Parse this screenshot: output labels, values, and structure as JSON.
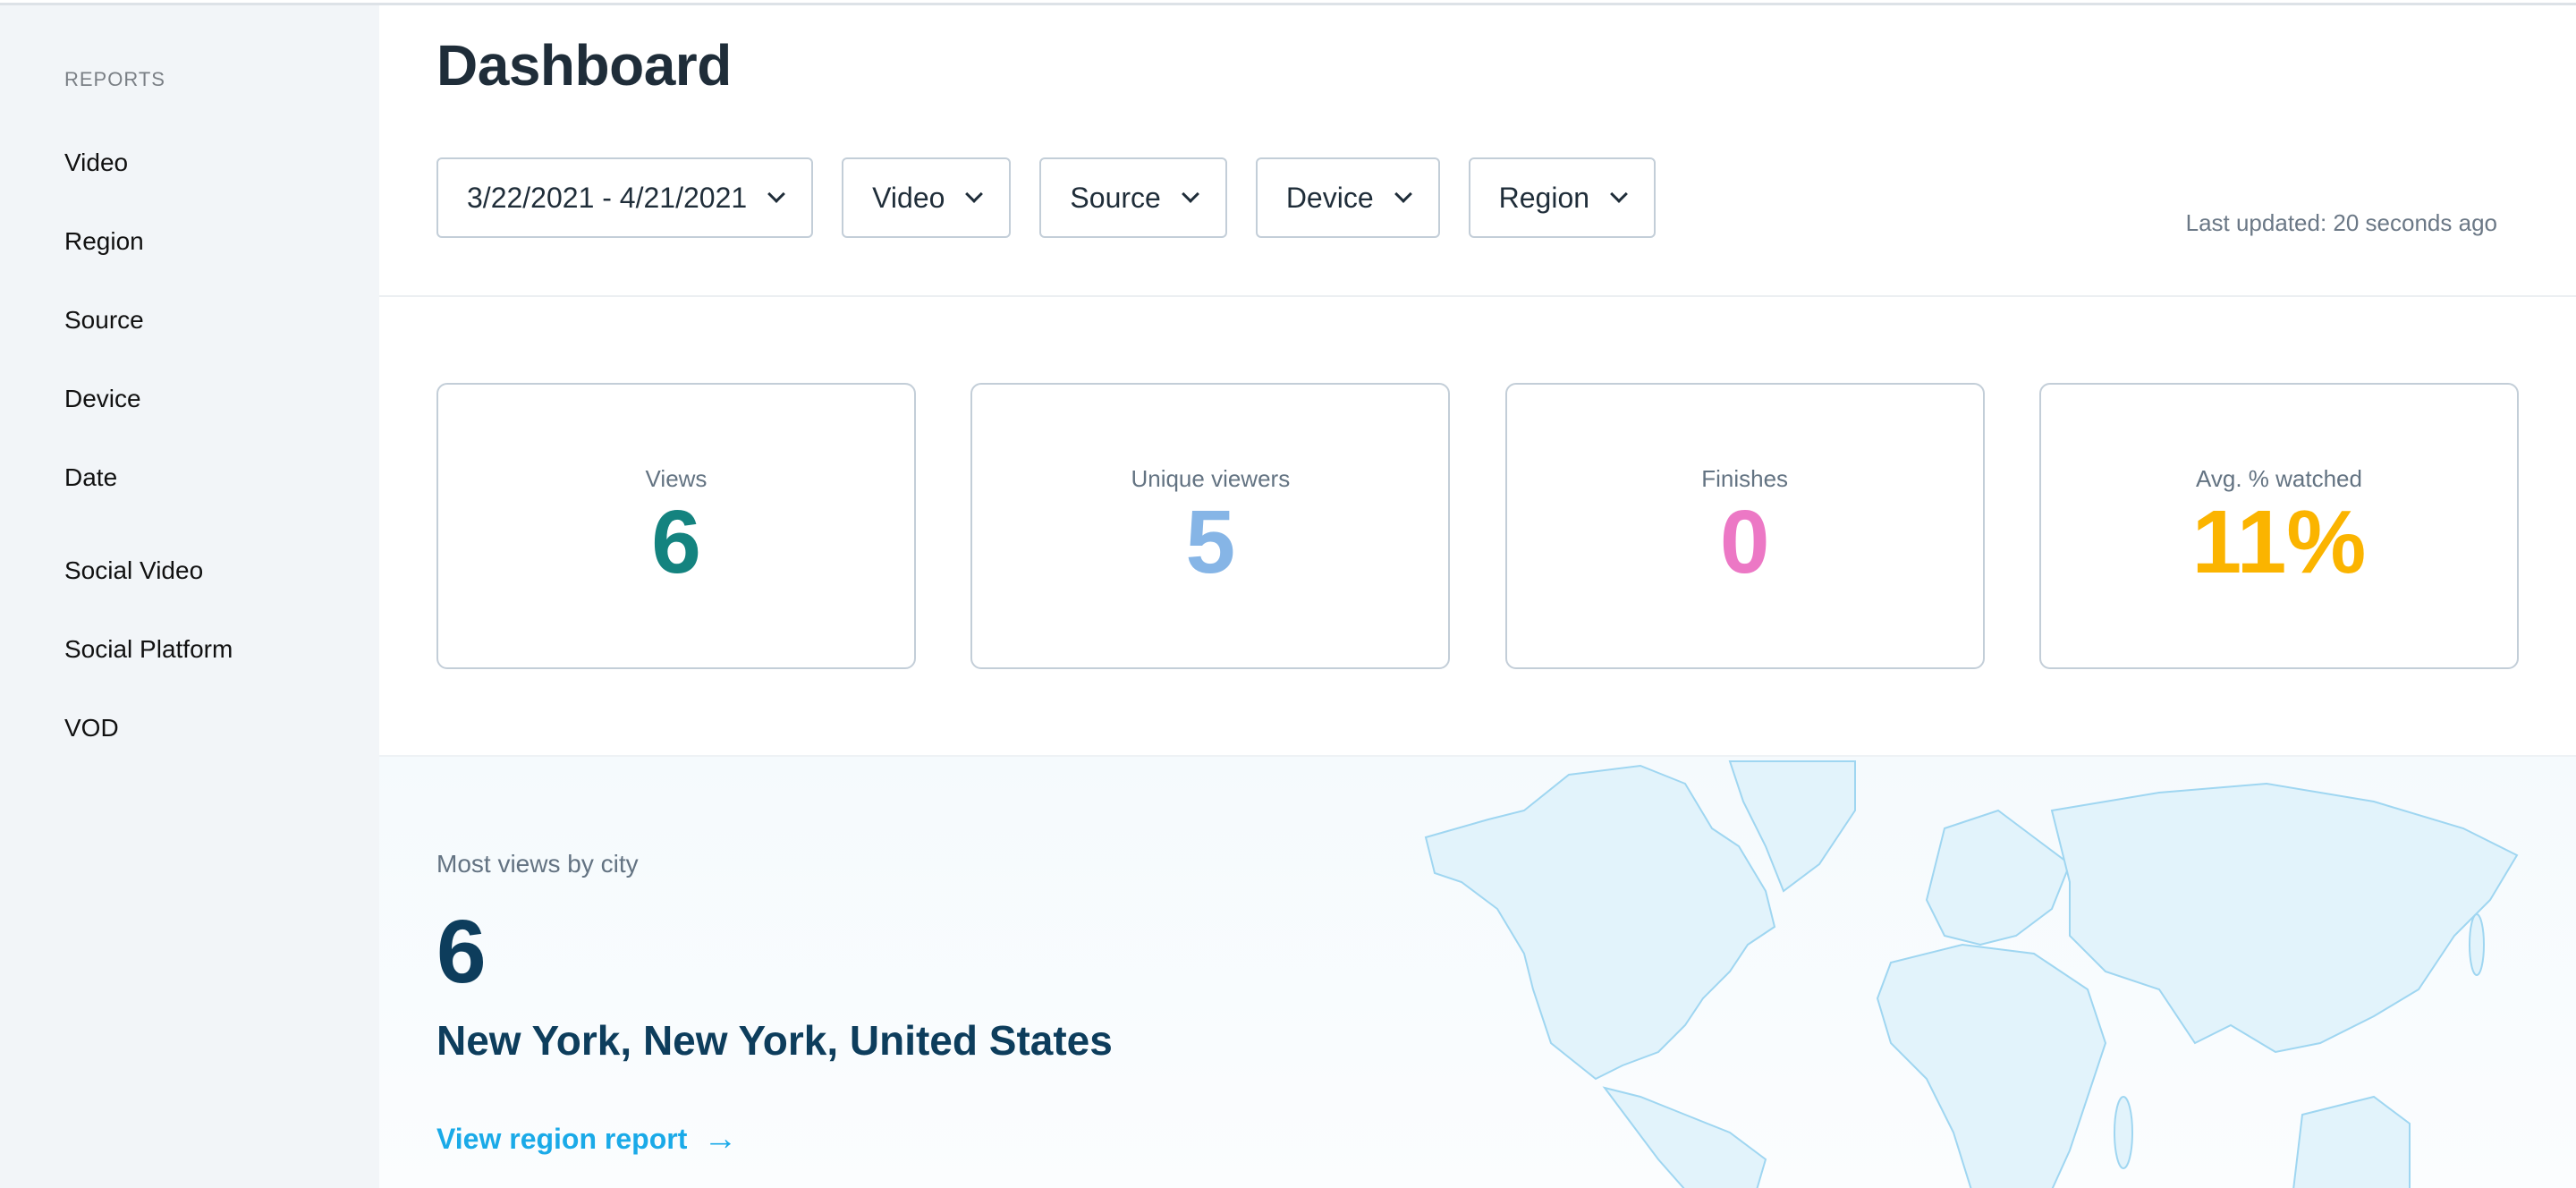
{
  "sidebar": {
    "heading": "REPORTS",
    "items": [
      {
        "label": "Video"
      },
      {
        "label": "Region"
      },
      {
        "label": "Source"
      },
      {
        "label": "Device"
      },
      {
        "label": "Date"
      },
      {
        "label": "Social Video"
      },
      {
        "label": "Social Platform"
      },
      {
        "label": "VOD"
      }
    ]
  },
  "header": {
    "title": "Dashboard",
    "last_updated": "Last updated: 20 seconds ago"
  },
  "filters": [
    {
      "label": "3/22/2021 - 4/21/2021",
      "icon": "chevron-down-icon"
    },
    {
      "label": "Video",
      "icon": "chevron-down-icon"
    },
    {
      "label": "Source",
      "icon": "chevron-down-icon"
    },
    {
      "label": "Device",
      "icon": "chevron-down-icon"
    },
    {
      "label": "Region",
      "icon": "chevron-down-icon"
    }
  ],
  "stats": [
    {
      "label": "Views",
      "value": "6",
      "color": "#14837f"
    },
    {
      "label": "Unique viewers",
      "value": "5",
      "color": "#86b5e6"
    },
    {
      "label": "Finishes",
      "value": "0",
      "color": "#ec78c5"
    },
    {
      "label": "Avg. % watched",
      "value": "11%",
      "color": "#fbb400"
    }
  ],
  "city": {
    "subtitle": "Most views by city",
    "value": "6",
    "name": "New York, New York, United States",
    "link_label": "View region report",
    "link_icon": "arrow-right-icon"
  },
  "colors": {
    "sidebar_bg": "#f2f5f8",
    "title": "#1f2d39",
    "link": "#1aaae8",
    "city": "#0d3d5c",
    "map_fill": "#e2f3fb",
    "map_stroke": "#9fd6f1"
  }
}
